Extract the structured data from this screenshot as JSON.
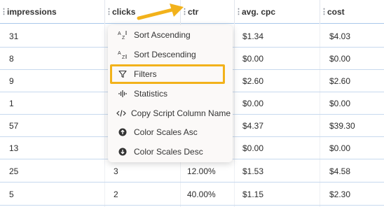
{
  "columns": [
    "impressions",
    "clicks",
    "ctr",
    "avg. cpc",
    "cost"
  ],
  "rows": [
    {
      "impressions": "31",
      "clicks": "",
      "ctr": "",
      "cpc": "$1.34",
      "cost": "$4.03"
    },
    {
      "impressions": "8",
      "clicks": "",
      "ctr": "",
      "cpc": "$0.00",
      "cost": "$0.00"
    },
    {
      "impressions": "9",
      "clicks": "",
      "ctr": "",
      "cpc": "$2.60",
      "cost": "$2.60"
    },
    {
      "impressions": "1",
      "clicks": "",
      "ctr": "",
      "cpc": "$0.00",
      "cost": "$0.00"
    },
    {
      "impressions": "57",
      "clicks": "",
      "ctr": "",
      "cpc": "$4.37",
      "cost": "$39.30"
    },
    {
      "impressions": "13",
      "clicks": "",
      "ctr": "",
      "cpc": "$0.00",
      "cost": "$0.00"
    },
    {
      "impressions": "25",
      "clicks": "3",
      "ctr": "12.00%",
      "cpc": "$1.53",
      "cost": "$4.58"
    },
    {
      "impressions": "5",
      "clicks": "2",
      "ctr": "40.00%",
      "cpc": "$1.15",
      "cost": "$2.30"
    }
  ],
  "menu": {
    "items": [
      {
        "label": "Sort Ascending",
        "icon": "sort-az-icon"
      },
      {
        "label": "Sort Descending",
        "icon": "sort-za-icon"
      },
      {
        "label": "Filters",
        "icon": "filter-icon"
      },
      {
        "label": "Statistics",
        "icon": "statistics-icon"
      },
      {
        "label": "Copy Script Column Name",
        "icon": "code-icon"
      },
      {
        "label": "Color Scales Asc",
        "icon": "arrow-up-circle-icon"
      },
      {
        "label": "Color Scales Desc",
        "icon": "arrow-down-circle-icon"
      }
    ],
    "highlighted": "Filters"
  },
  "colors": {
    "highlight": "#f2b21b",
    "arrow": "#f2b21b",
    "header_border": "#a9c8ea"
  }
}
